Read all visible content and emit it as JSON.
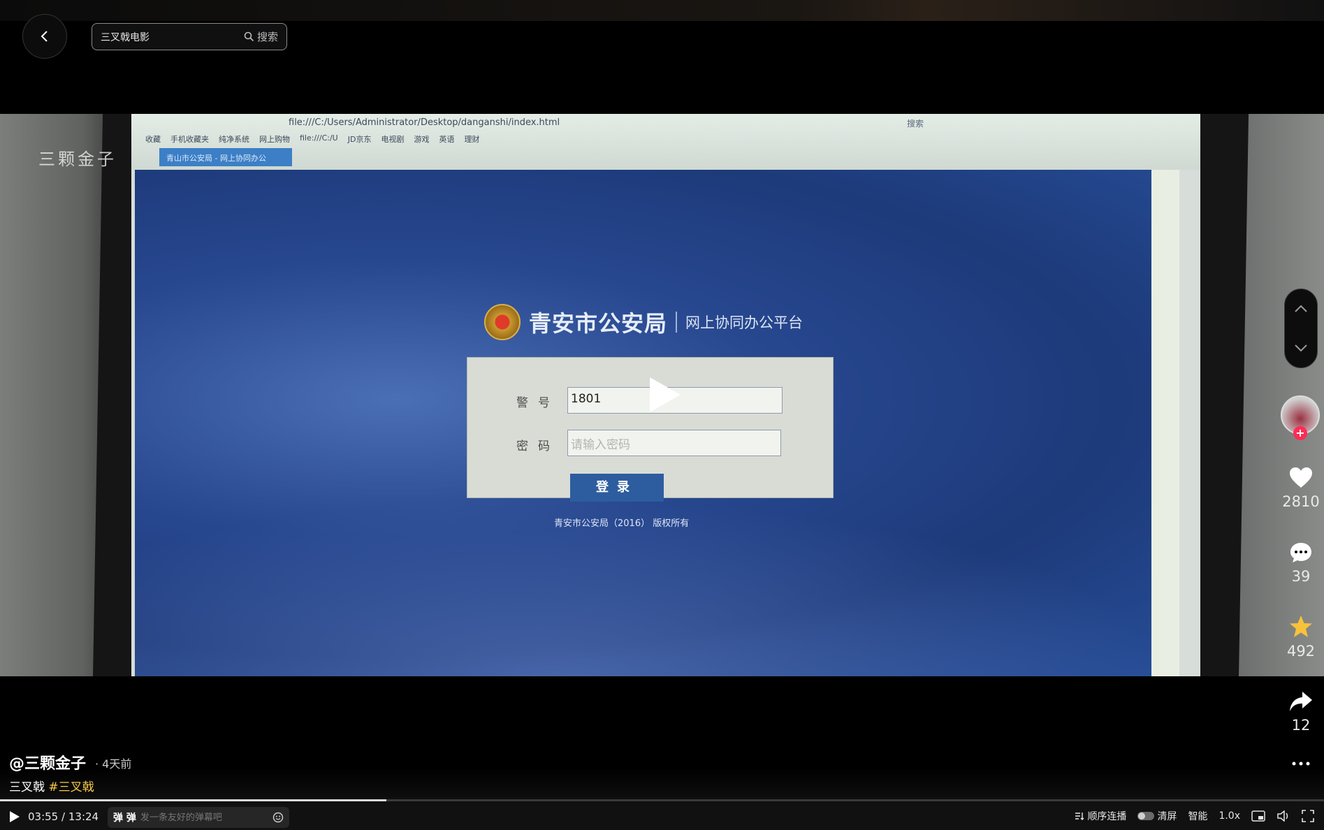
{
  "header": {
    "search_value": "三叉戟电影",
    "search_button": "搜索"
  },
  "video_frame": {
    "watermark": "三颗金子",
    "browser_url": "file:///C:/Users/Administrator/Desktop/danganshi/index.html",
    "browser_search": "搜索",
    "bookmarks": [
      "收藏",
      "手机收藏夹",
      "纯净系统",
      "网上购物",
      "file:///C:/U",
      "JD京东",
      "电视剧",
      "游戏",
      "英语",
      "理财"
    ],
    "tab_title": "青山市公安局 - 网上协同办公",
    "brand_title": "青安市公安局",
    "brand_subtitle": "网上协同办公平台",
    "label_badge": "警号",
    "badge_value": "1801",
    "label_password": "密码",
    "password_placeholder": "请输入密码",
    "login_button": "登录",
    "copyright": "青安市公安局（2016） 版权所有"
  },
  "sidebar": {
    "likes": "2810",
    "comments": "39",
    "favorites": "492",
    "shares": "12"
  },
  "info": {
    "author": "@三颗金子",
    "time_ago": "· 4天前",
    "desc_text": "三叉戟",
    "hashtag": "#三叉戟"
  },
  "player": {
    "current_time": "03:55",
    "separator": "/",
    "duration": "13:24",
    "progress_fraction": 0.292,
    "danmu_placeholder": "发一条友好的弹幕吧",
    "danmu_toggle_icons": "弹 弹",
    "autoplay": "顺序连播",
    "clear_screen": "清屏",
    "quality": "智能",
    "speed": "1.0x"
  }
}
